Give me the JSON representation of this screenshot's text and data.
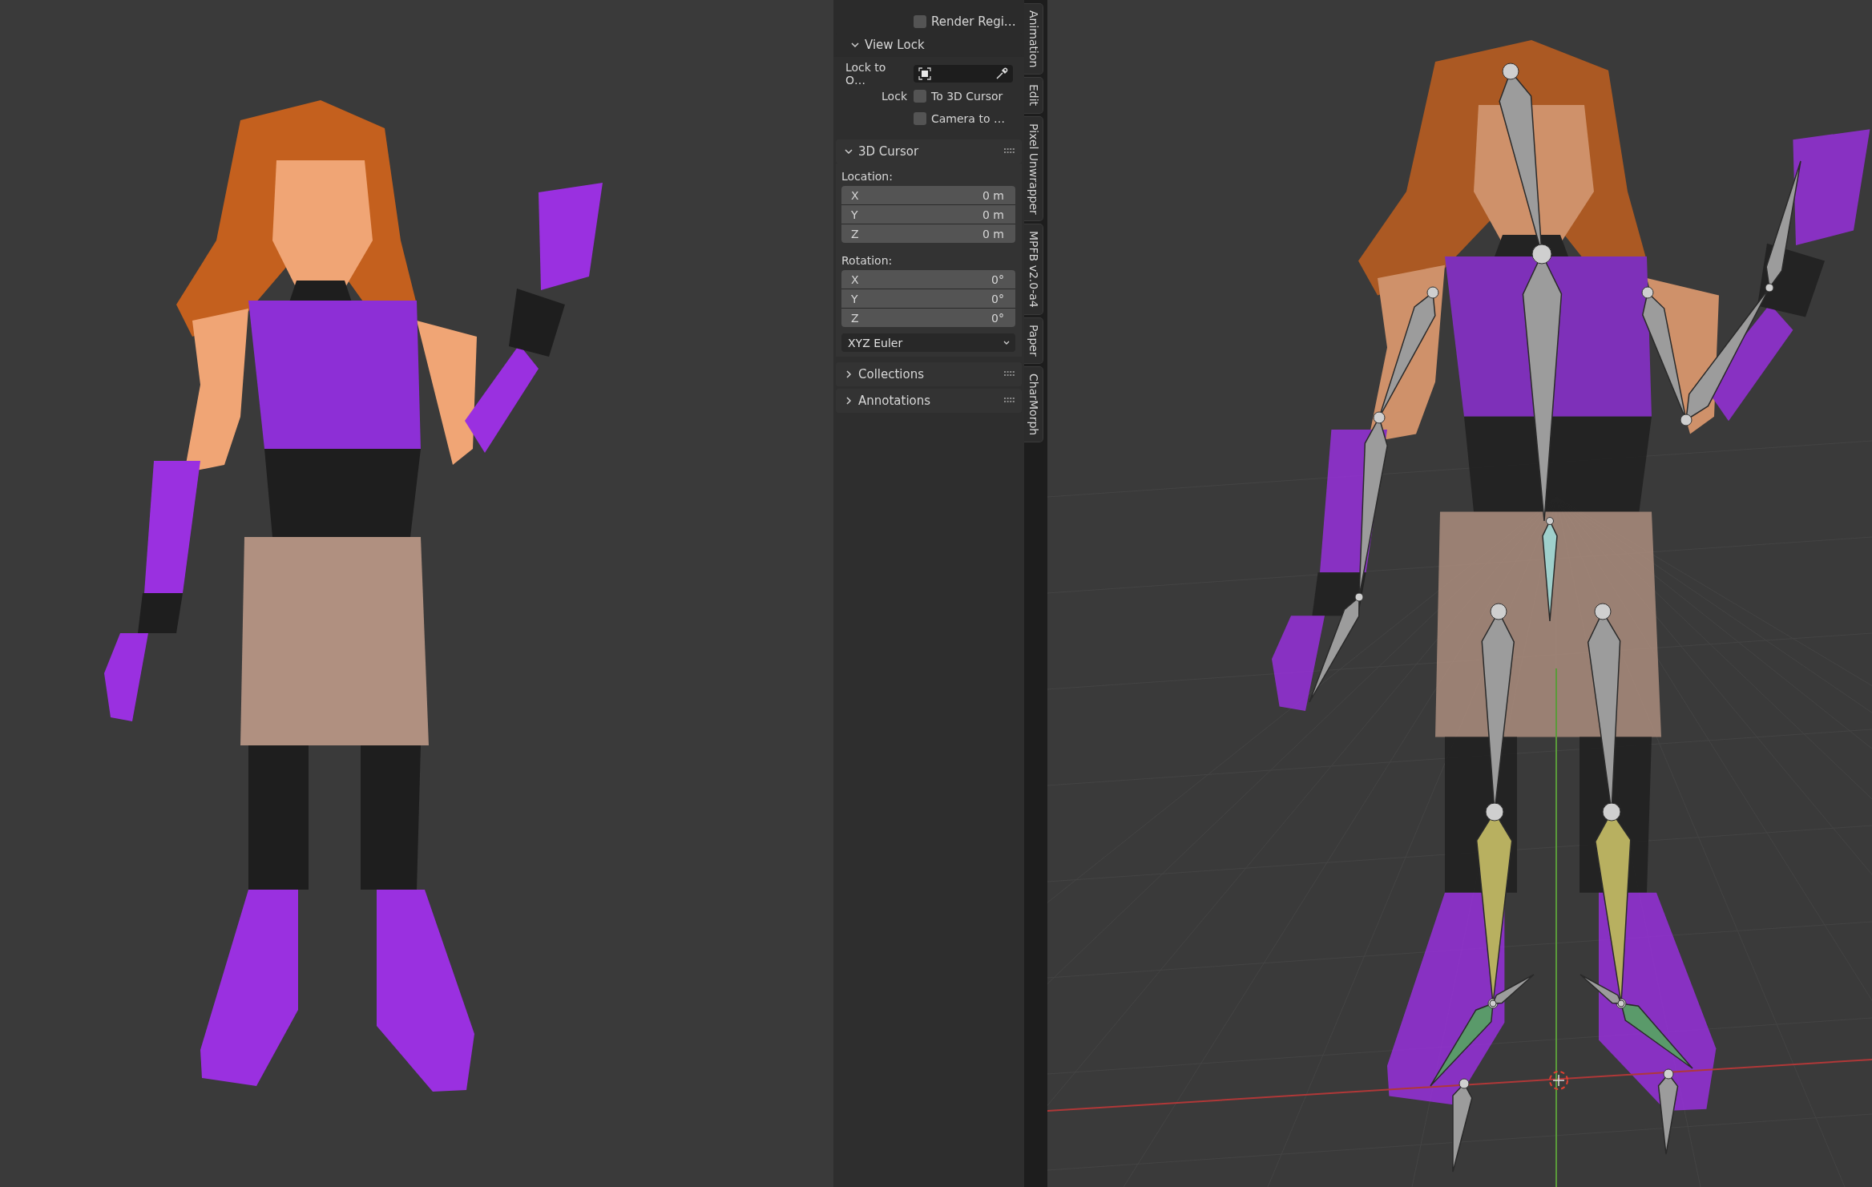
{
  "viewports": [
    {
      "kind": "model"
    },
    {
      "kind": "armature"
    }
  ],
  "sidebar": {
    "render_region": {
      "label": "Render Regi…",
      "checked": false
    },
    "view_lock": {
      "title": "View Lock",
      "expanded": true,
      "lock_to_object_label": "Lock to O…",
      "lock_label": "Lock",
      "options": [
        {
          "label": "To 3D Cursor",
          "checked": false
        },
        {
          "label": "Camera to …",
          "checked": false
        }
      ]
    },
    "cursor": {
      "title": "3D Cursor",
      "expanded": true,
      "location_label": "Location:",
      "location": [
        {
          "axis": "X",
          "value": "0 m"
        },
        {
          "axis": "Y",
          "value": "0 m"
        },
        {
          "axis": "Z",
          "value": "0 m"
        }
      ],
      "rotation_label": "Rotation:",
      "rotation": [
        {
          "axis": "X",
          "value": "0°"
        },
        {
          "axis": "Y",
          "value": "0°"
        },
        {
          "axis": "Z",
          "value": "0°"
        }
      ],
      "rotation_mode": "XYZ Euler"
    },
    "collapsed_panels": [
      {
        "title": "Collections",
        "expanded": false
      },
      {
        "title": "Annotations",
        "expanded": false
      }
    ]
  },
  "tabs": [
    {
      "label": "Animation"
    },
    {
      "label": "Edit"
    },
    {
      "label": "Pixel Unwrapper"
    },
    {
      "label": "MPFB v2.0-a4"
    },
    {
      "label": "Paper"
    },
    {
      "label": "CharMorph"
    }
  ]
}
